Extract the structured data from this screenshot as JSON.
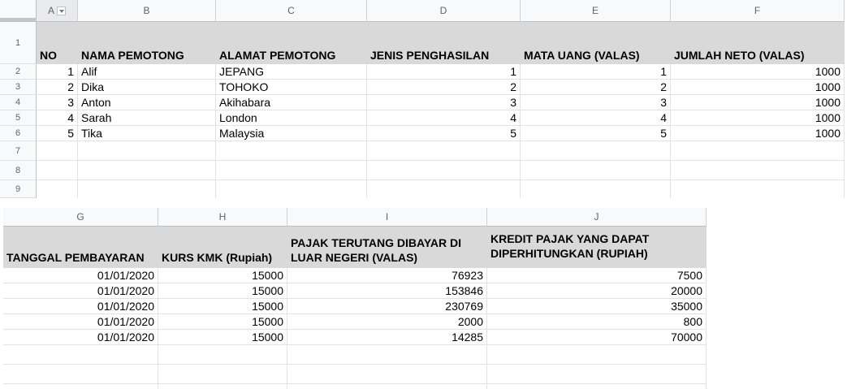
{
  "top": {
    "columns": [
      "A",
      "B",
      "C",
      "D",
      "E",
      "F"
    ],
    "rows": [
      "1",
      "2",
      "3",
      "4",
      "5",
      "6",
      "7",
      "8",
      "9"
    ],
    "headers": [
      "NO",
      "NAMA PEMOTONG",
      "ALAMAT PEMOTONG",
      "JENIS PENGHASILAN",
      "MATA UANG (VALAS)",
      "JUMLAH NETO (VALAS)"
    ],
    "data": [
      {
        "no": "1",
        "nama": "Alif",
        "alamat": "JEPANG",
        "jenis": "1",
        "mata": "1",
        "jumlah": "1000"
      },
      {
        "no": "2",
        "nama": "Dika",
        "alamat": "TOHOKO",
        "jenis": "2",
        "mata": "2",
        "jumlah": "1000"
      },
      {
        "no": "3",
        "nama": "Anton",
        "alamat": "Akihabara",
        "jenis": "3",
        "mata": "3",
        "jumlah": "1000"
      },
      {
        "no": "4",
        "nama": "Sarah",
        "alamat": "London",
        "jenis": "4",
        "mata": "4",
        "jumlah": "1000"
      },
      {
        "no": "5",
        "nama": "Tika",
        "alamat": "Malaysia",
        "jenis": "5",
        "mata": "5",
        "jumlah": "1000"
      }
    ]
  },
  "bottom": {
    "columns": [
      "G",
      "H",
      "I",
      "J"
    ],
    "headers": [
      "TANGGAL PEMBAYARAN",
      "KURS KMK (Rupiah)",
      "PAJAK TERUTANG DIBAYAR DI LUAR NEGERI (VALAS)",
      "KREDIT PAJAK YANG DAPAT DIPERHITUNGKAN (RUPIAH)"
    ],
    "data": [
      {
        "tanggal": "01/01/2020",
        "kurs": "15000",
        "pajak": "76923",
        "kredit": "7500"
      },
      {
        "tanggal": "01/01/2020",
        "kurs": "15000",
        "pajak": "153846",
        "kredit": "20000"
      },
      {
        "tanggal": "01/01/2020",
        "kurs": "15000",
        "pajak": "230769",
        "kredit": "35000"
      },
      {
        "tanggal": "01/01/2020",
        "kurs": "15000",
        "pajak": "2000",
        "kredit": "800"
      },
      {
        "tanggal": "01/01/2020",
        "kurs": "15000",
        "pajak": "14285",
        "kredit": "70000"
      }
    ]
  }
}
